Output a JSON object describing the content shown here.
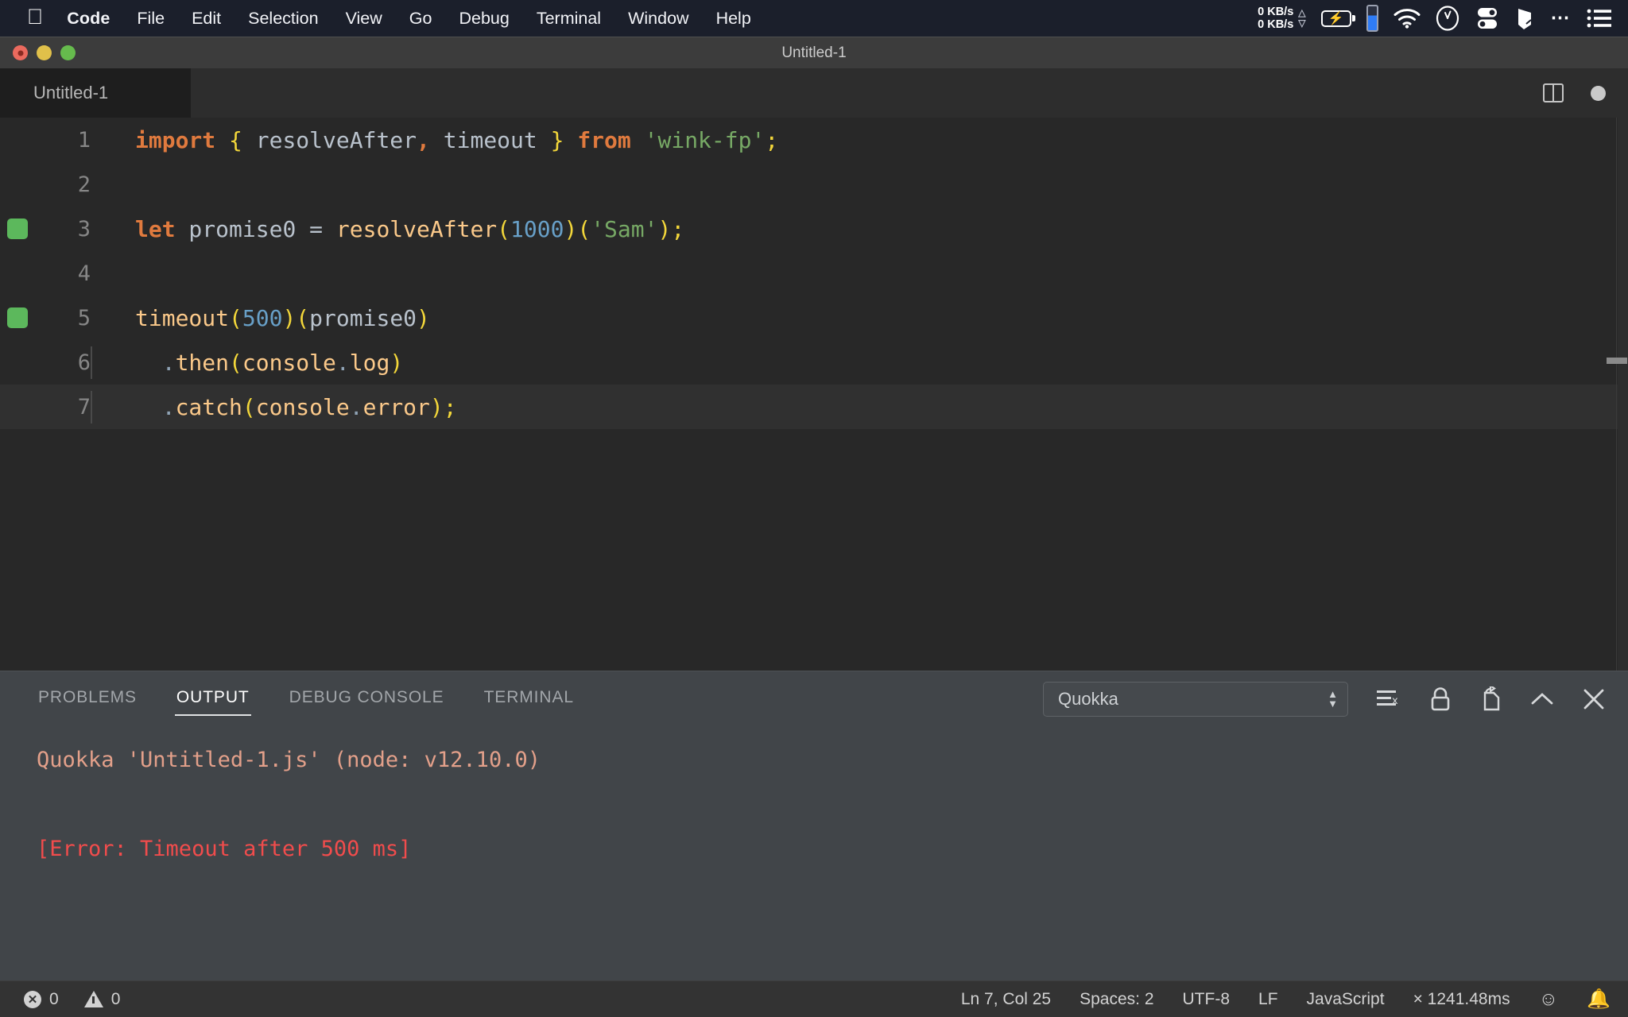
{
  "menubar": {
    "apple_icon": "apple-logo-icon",
    "items": [
      "Code",
      "File",
      "Edit",
      "Selection",
      "View",
      "Go",
      "Debug",
      "Terminal",
      "Window",
      "Help"
    ],
    "active_app": "Code",
    "status": {
      "network_up": "0 KB/s",
      "network_down": "0 KB/s",
      "up_arrow": "△",
      "down_arrow": "▽",
      "icons": [
        "battery-charging-icon",
        "blue-level-indicator-icon",
        "wifi-icon",
        "clock-icon",
        "toggles-icon",
        "shape-pen-icon",
        "ellipsis-icon",
        "list-menu-icon"
      ]
    }
  },
  "window": {
    "title": "Untitled-1",
    "traffic_lights": [
      "close",
      "minimize",
      "maximize"
    ]
  },
  "editor": {
    "tab_label": "Untitled-1",
    "actions": [
      "split-editor-icon",
      "unsaved-dot-icon"
    ],
    "lines": [
      {
        "number": "1",
        "marker": false,
        "indent_guide": false,
        "tokens": [
          {
            "t": "import",
            "c": "kw"
          },
          {
            "t": " ",
            "c": "op"
          },
          {
            "t": "{",
            "c": "punc"
          },
          {
            "t": " resolveAfter",
            "c": "id"
          },
          {
            "t": ",",
            "c": "kw"
          },
          {
            "t": " timeout ",
            "c": "id"
          },
          {
            "t": "}",
            "c": "punc"
          },
          {
            "t": " ",
            "c": "op"
          },
          {
            "t": "from",
            "c": "kw"
          },
          {
            "t": " ",
            "c": "op"
          },
          {
            "t": "'wink-fp'",
            "c": "str"
          },
          {
            "t": ";",
            "c": "punc"
          }
        ]
      },
      {
        "number": "2",
        "marker": false,
        "indent_guide": false,
        "tokens": []
      },
      {
        "number": "3",
        "marker": true,
        "indent_guide": false,
        "tokens": [
          {
            "t": "let",
            "c": "kw"
          },
          {
            "t": " promise0 ",
            "c": "id"
          },
          {
            "t": "=",
            "c": "op"
          },
          {
            "t": " ",
            "c": "op"
          },
          {
            "t": "resolveAfter",
            "c": "fn"
          },
          {
            "t": "(",
            "c": "punc"
          },
          {
            "t": "1000",
            "c": "num"
          },
          {
            "t": ")(",
            "c": "punc"
          },
          {
            "t": "'Sam'",
            "c": "str"
          },
          {
            "t": ")",
            "c": "punc"
          },
          {
            "t": ";",
            "c": "punc"
          }
        ]
      },
      {
        "number": "4",
        "marker": false,
        "indent_guide": false,
        "tokens": []
      },
      {
        "number": "5",
        "marker": true,
        "indent_guide": false,
        "tokens": [
          {
            "t": "timeout",
            "c": "fn"
          },
          {
            "t": "(",
            "c": "punc"
          },
          {
            "t": "500",
            "c": "num"
          },
          {
            "t": ")(",
            "c": "punc"
          },
          {
            "t": "promise0",
            "c": "id"
          },
          {
            "t": ")",
            "c": "punc"
          }
        ]
      },
      {
        "number": "6",
        "marker": false,
        "indent_guide": true,
        "tokens": [
          {
            "t": "  ",
            "c": "op"
          },
          {
            "t": ".",
            "c": "dot"
          },
          {
            "t": "then",
            "c": "fn"
          },
          {
            "t": "(",
            "c": "punc"
          },
          {
            "t": "console",
            "c": "fn"
          },
          {
            "t": ".",
            "c": "dot"
          },
          {
            "t": "log",
            "c": "fn"
          },
          {
            "t": ")",
            "c": "punc"
          }
        ]
      },
      {
        "number": "7",
        "marker": false,
        "indent_guide": true,
        "active": true,
        "tokens": [
          {
            "t": "  ",
            "c": "op"
          },
          {
            "t": ".",
            "c": "dot"
          },
          {
            "t": "catch",
            "c": "fn"
          },
          {
            "t": "(",
            "c": "punc"
          },
          {
            "t": "console",
            "c": "fn"
          },
          {
            "t": ".",
            "c": "dot"
          },
          {
            "t": "error",
            "c": "fn"
          },
          {
            "t": ")",
            "c": "punc"
          },
          {
            "t": ";",
            "c": "punc"
          }
        ]
      }
    ]
  },
  "panel": {
    "tabs": [
      {
        "label": "PROBLEMS",
        "active": false
      },
      {
        "label": "OUTPUT",
        "active": true
      },
      {
        "label": "DEBUG CONSOLE",
        "active": false
      },
      {
        "label": "TERMINAL",
        "active": false
      }
    ],
    "channel_select": {
      "value": "Quokka",
      "options": [
        "Quokka"
      ]
    },
    "actions": [
      "clear-output-icon",
      "lock-icon",
      "open-in-editor-icon",
      "maximize-panel-icon",
      "close-panel-icon"
    ],
    "output_lines": [
      {
        "text": "Quokka 'Untitled-1.js' (node: v12.10.0)",
        "kind": "info"
      },
      {
        "text": "",
        "kind": "blank"
      },
      {
        "text": "[Error: Timeout after 500 ms]",
        "kind": "error"
      }
    ]
  },
  "statusbar": {
    "errors_count": "0",
    "warnings_count": "0",
    "cursor": "Ln 7, Col 25",
    "spaces": "Spaces: 2",
    "encoding": "UTF-8",
    "eol": "LF",
    "language": "JavaScript",
    "timing": "× 1241.48ms",
    "icons": [
      "error-icon",
      "warning-icon",
      "smiley-feedback-icon",
      "bell-notifications-icon"
    ]
  },
  "colors": {
    "menubar_bg": "#1b1f2b",
    "titlebar_bg": "#3c3c3c",
    "editor_bg": "#282828",
    "panel_bg": "#414549",
    "statusbar_bg": "#333333",
    "marker_green": "#5cb85c",
    "error_red": "#f14c4c",
    "output_info": "#e3a08a",
    "accent_blue": "#2f7cf6"
  }
}
